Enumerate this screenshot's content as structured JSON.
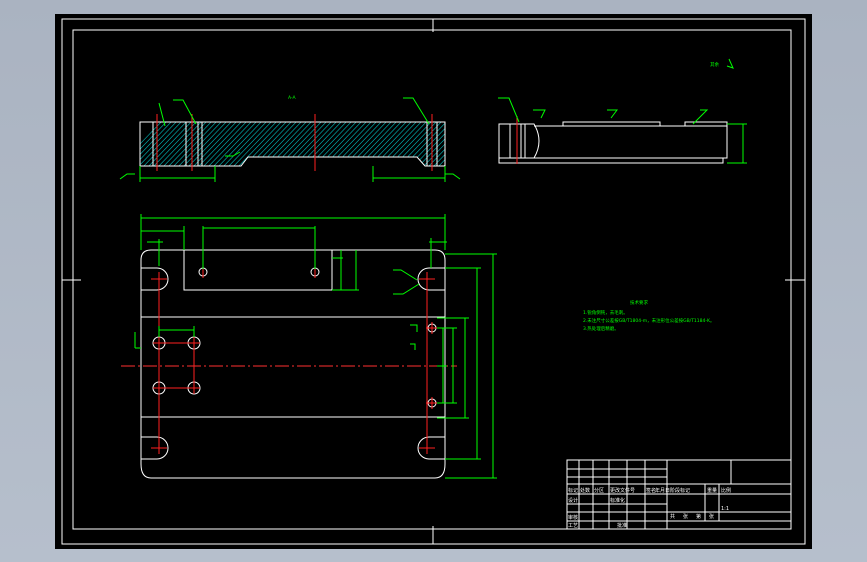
{
  "drawing": {
    "section_label": "A-A",
    "tech_title": "技术要求",
    "tech_notes": [
      "1.锐角倒钝，去毛刺。",
      "2.未注尺寸公差按GB/T1804-m，未注形位公差按GB/T1184-K。",
      "3.热处理后精磨。"
    ],
    "roughness_note": "其余",
    "colors": {
      "sheet": "#000000",
      "outline": "#ffffff",
      "dimension": "#00ff00",
      "centerline": "#ff2020",
      "hatch": "#00c0c0"
    }
  },
  "title_block": {
    "rows": [
      [
        "标记",
        "处数",
        "分区",
        "更改文件号",
        "签名",
        "年月日"
      ],
      [
        "设计",
        "",
        "",
        "标准化",
        "",
        ""
      ],
      [
        "审核",
        "",
        "",
        "",
        "",
        ""
      ],
      [
        "工艺",
        "",
        "",
        "批准",
        "",
        ""
      ]
    ],
    "stage_labels": [
      "阶段标记",
      "重量",
      "比例"
    ],
    "scale": "1:1",
    "sheet_labels": [
      "共",
      "张",
      "第",
      "张"
    ]
  }
}
